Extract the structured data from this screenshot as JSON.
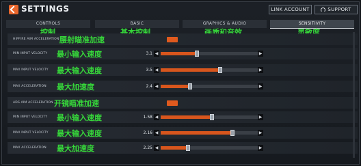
{
  "header": {
    "title": "SETTINGS",
    "link_account": "LINK ACCOUNT",
    "support": "SUPPORT"
  },
  "tabs": [
    {
      "label": "CONTROLS",
      "overlay": "控制"
    },
    {
      "label": "BASIC",
      "overlay": "基本控制"
    },
    {
      "label": "GRAPHICS & AUDIO",
      "overlay": "画质和音效"
    },
    {
      "label": "SENSITIVITY",
      "overlay": "灵敏度"
    }
  ],
  "rows": [
    {
      "label": "HIPFIRE AIM ACCELERATION",
      "overlay": "腰射瞄准加速",
      "type": "toggle"
    },
    {
      "label": "MIN INPUT VELOCITY",
      "overlay": "最小输入速度",
      "type": "slider",
      "value": "3.1",
      "level": 0.37
    },
    {
      "label": "MAX INPUT VELOCITY",
      "overlay": "最大输入速度",
      "type": "slider",
      "value": "3.5",
      "level": 0.61
    },
    {
      "label": "MAX ACCELERATION",
      "overlay": "最大加速度",
      "type": "slider",
      "value": "2.4",
      "level": 0.3
    },
    {
      "label": "ADS AIM ACCELERATION",
      "overlay": "开镜瞄准加速",
      "type": "toggle"
    },
    {
      "label": "MIN INPUT VELOCITY",
      "overlay": "最小输入速度",
      "type": "slider",
      "value": "1.58",
      "level": 0.53
    },
    {
      "label": "MAX INPUT VELOCITY",
      "overlay": "最大输入速度",
      "type": "slider",
      "value": "2.16",
      "level": 0.74
    },
    {
      "label": "MAX ACCELERATION",
      "overlay": "最大加速度",
      "type": "slider",
      "value": "2.25",
      "level": 0.28
    }
  ],
  "colors": {
    "accent": "#d8561d",
    "overlay": "#36d63a"
  },
  "icons": {
    "logo": "apex-logo-icon",
    "support": "help-circle-icon"
  }
}
